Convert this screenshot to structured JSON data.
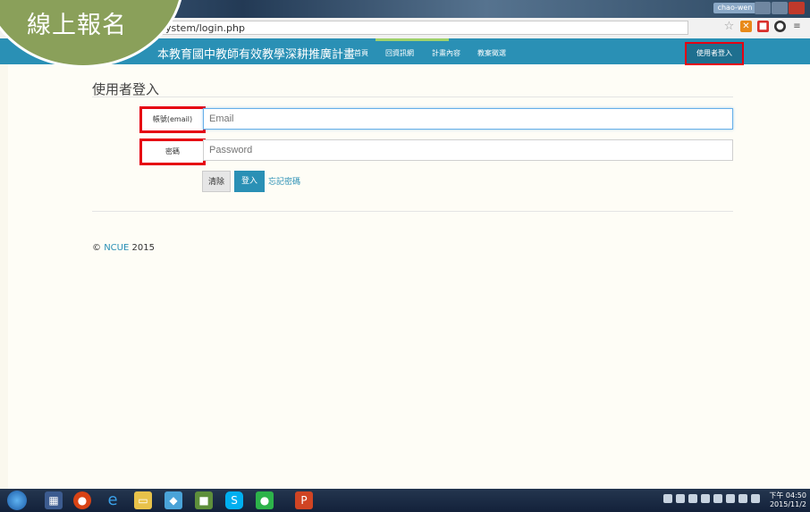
{
  "browser": {
    "user_pill": "chao-wen",
    "address": "ystem/login.php",
    "ext_star": "☆"
  },
  "badge": {
    "text": "線上報名"
  },
  "navbar": {
    "title": "本教育國中教師有效教學深耕推廣計畫",
    "links": [
      "首頁",
      "回資訊網",
      "計畫內容",
      "教案徵選"
    ],
    "login_button": "使用者登入"
  },
  "form": {
    "heading": "使用者登入",
    "account_label": "帳號(email)",
    "email_placeholder": "Email",
    "password_label": "密碼",
    "password_placeholder": "Password",
    "clear_button": "清除",
    "login_button": "登入",
    "forgot_link": "忘記密碼"
  },
  "footer": {
    "copyright": "©",
    "brand": "NCUE",
    "year": "2015"
  },
  "taskbar": {
    "time": "下午 04:50",
    "date": "2015/11/2"
  }
}
